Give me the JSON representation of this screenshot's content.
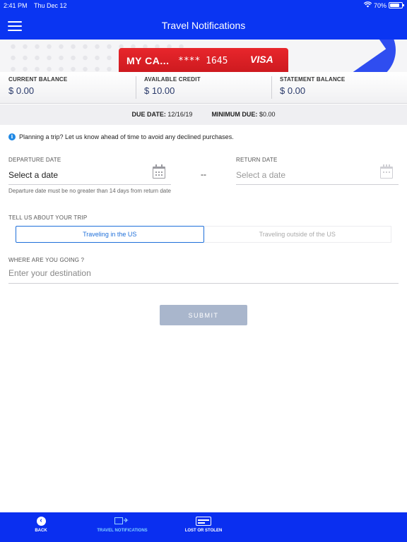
{
  "status_bar": {
    "time": "2:41 PM",
    "date": "Thu Dec 12",
    "battery": "70%",
    "battery_level": 0.7
  },
  "header": {
    "title": "Travel Notifications",
    "menu_icon": "hamburger-icon"
  },
  "card": {
    "name": "MY CA...",
    "number": "**** 1645",
    "brand": "VISA",
    "color": "#d51f25"
  },
  "balances": [
    {
      "label": "CURRENT BALANCE",
      "value": "$ 0.00"
    },
    {
      "label": "AVAILABLE CREDIT",
      "value": "$ 10.00"
    },
    {
      "label": "STATEMENT BALANCE",
      "value": "$ 0.00"
    }
  ],
  "due": {
    "due_label": "DUE DATE:",
    "due_value": "12/16/19",
    "min_label": "MINIMUM DUE:",
    "min_value": "$0.00"
  },
  "info_text": "Planning a trip? Let us know ahead of time to avoid any declined purchases.",
  "departure": {
    "label": "DEPARTURE DATE",
    "value": "Select a date",
    "hint": "Departure date must be no greater than 14 days from return date"
  },
  "separator": "--",
  "return": {
    "label": "RETURN DATE",
    "value": "Select a date"
  },
  "trip": {
    "label": "TELL US ABOUT YOUR TRIP",
    "options": [
      "Traveling in the US",
      "Traveling outside of the US"
    ],
    "selected": "Traveling in the US"
  },
  "destination": {
    "label": "WHERE ARE YOU GOING ?",
    "placeholder": "Enter your destination",
    "value": ""
  },
  "submit_label": "SUBMIT",
  "tabs": [
    {
      "label": "BACK",
      "icon": "back-arrow-icon"
    },
    {
      "label": "TRAVEL NOTIFICATIONS",
      "icon": "travel-icon",
      "active": true
    },
    {
      "label": "LOST OR STOLEN",
      "icon": "card-icon"
    }
  ],
  "colors": {
    "brand_blue": "#0a35f2",
    "accent": "#1e6fd9",
    "submit_disabled": "#a9b6cc"
  }
}
